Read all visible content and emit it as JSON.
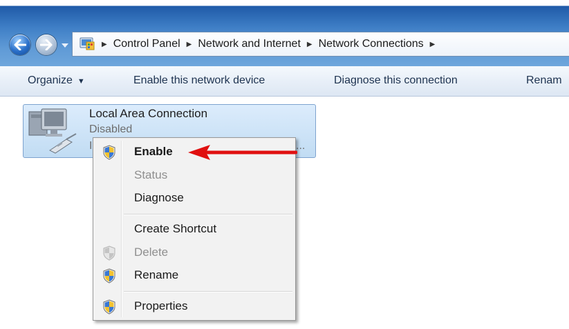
{
  "address_bar": {
    "breadcrumbs": [
      "Control Panel",
      "Network and Internet",
      "Network Connections"
    ]
  },
  "command_bar": {
    "organize": "Organize",
    "enable": "Enable this network device",
    "diagnose": "Diagnose this connection",
    "rename": "Renam"
  },
  "connection": {
    "name": "Local Area Connection",
    "status": "Disabled",
    "device_prefix": "I",
    "device_suffix": "..."
  },
  "context_menu": {
    "items": [
      {
        "label": "Enable",
        "icon": "uac-shield-icon",
        "enabled": true,
        "bold": true
      },
      {
        "label": "Status",
        "icon": null,
        "enabled": false
      },
      {
        "label": "Diagnose",
        "icon": null,
        "enabled": true
      },
      {
        "label": "Create Shortcut",
        "icon": null,
        "enabled": true
      },
      {
        "label": "Delete",
        "icon": "uac-shield-icon",
        "enabled": false
      },
      {
        "label": "Rename",
        "icon": "uac-shield-icon",
        "enabled": true
      },
      {
        "label": "Properties",
        "icon": "uac-shield-icon",
        "enabled": true
      }
    ]
  },
  "colors": {
    "title_bar": "#3f7fc6",
    "selection": "#c1dcf3",
    "annotation_arrow": "#e01010"
  }
}
